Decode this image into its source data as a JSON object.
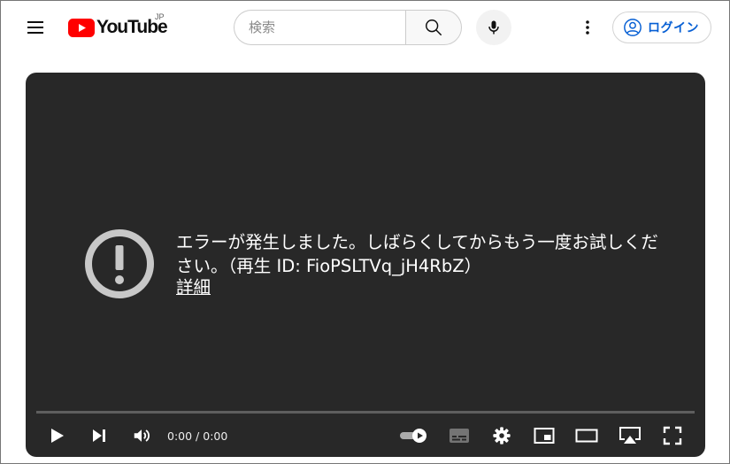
{
  "header": {
    "logo": {
      "text": "YouTube",
      "region": "JP"
    },
    "search": {
      "placeholder": "検索",
      "value": ""
    },
    "login": {
      "label": "ログイン"
    }
  },
  "player": {
    "error": {
      "message": "エラーが発生しました。しばらくしてからもう一度お試しください。（再生 ID: FioPSLTVq_jH4RbZ）",
      "details_link": "詳細"
    },
    "time": {
      "current": "0:00",
      "separator": " / ",
      "duration": "0:00"
    },
    "progress": 0,
    "autoplay": true
  },
  "colors": {
    "brand_red": "#ff0000",
    "link_blue": "#065fd4",
    "player_bg": "#282828"
  },
  "icons": [
    "menu-icon",
    "youtube-logo-icon",
    "search-icon",
    "mic-icon",
    "more-vert-icon",
    "account-icon",
    "error-icon",
    "play-icon",
    "next-icon",
    "volume-icon",
    "autoplay-toggle",
    "subtitles-icon",
    "settings-icon",
    "miniplayer-icon",
    "theater-icon",
    "airplay-icon",
    "fullscreen-icon"
  ]
}
